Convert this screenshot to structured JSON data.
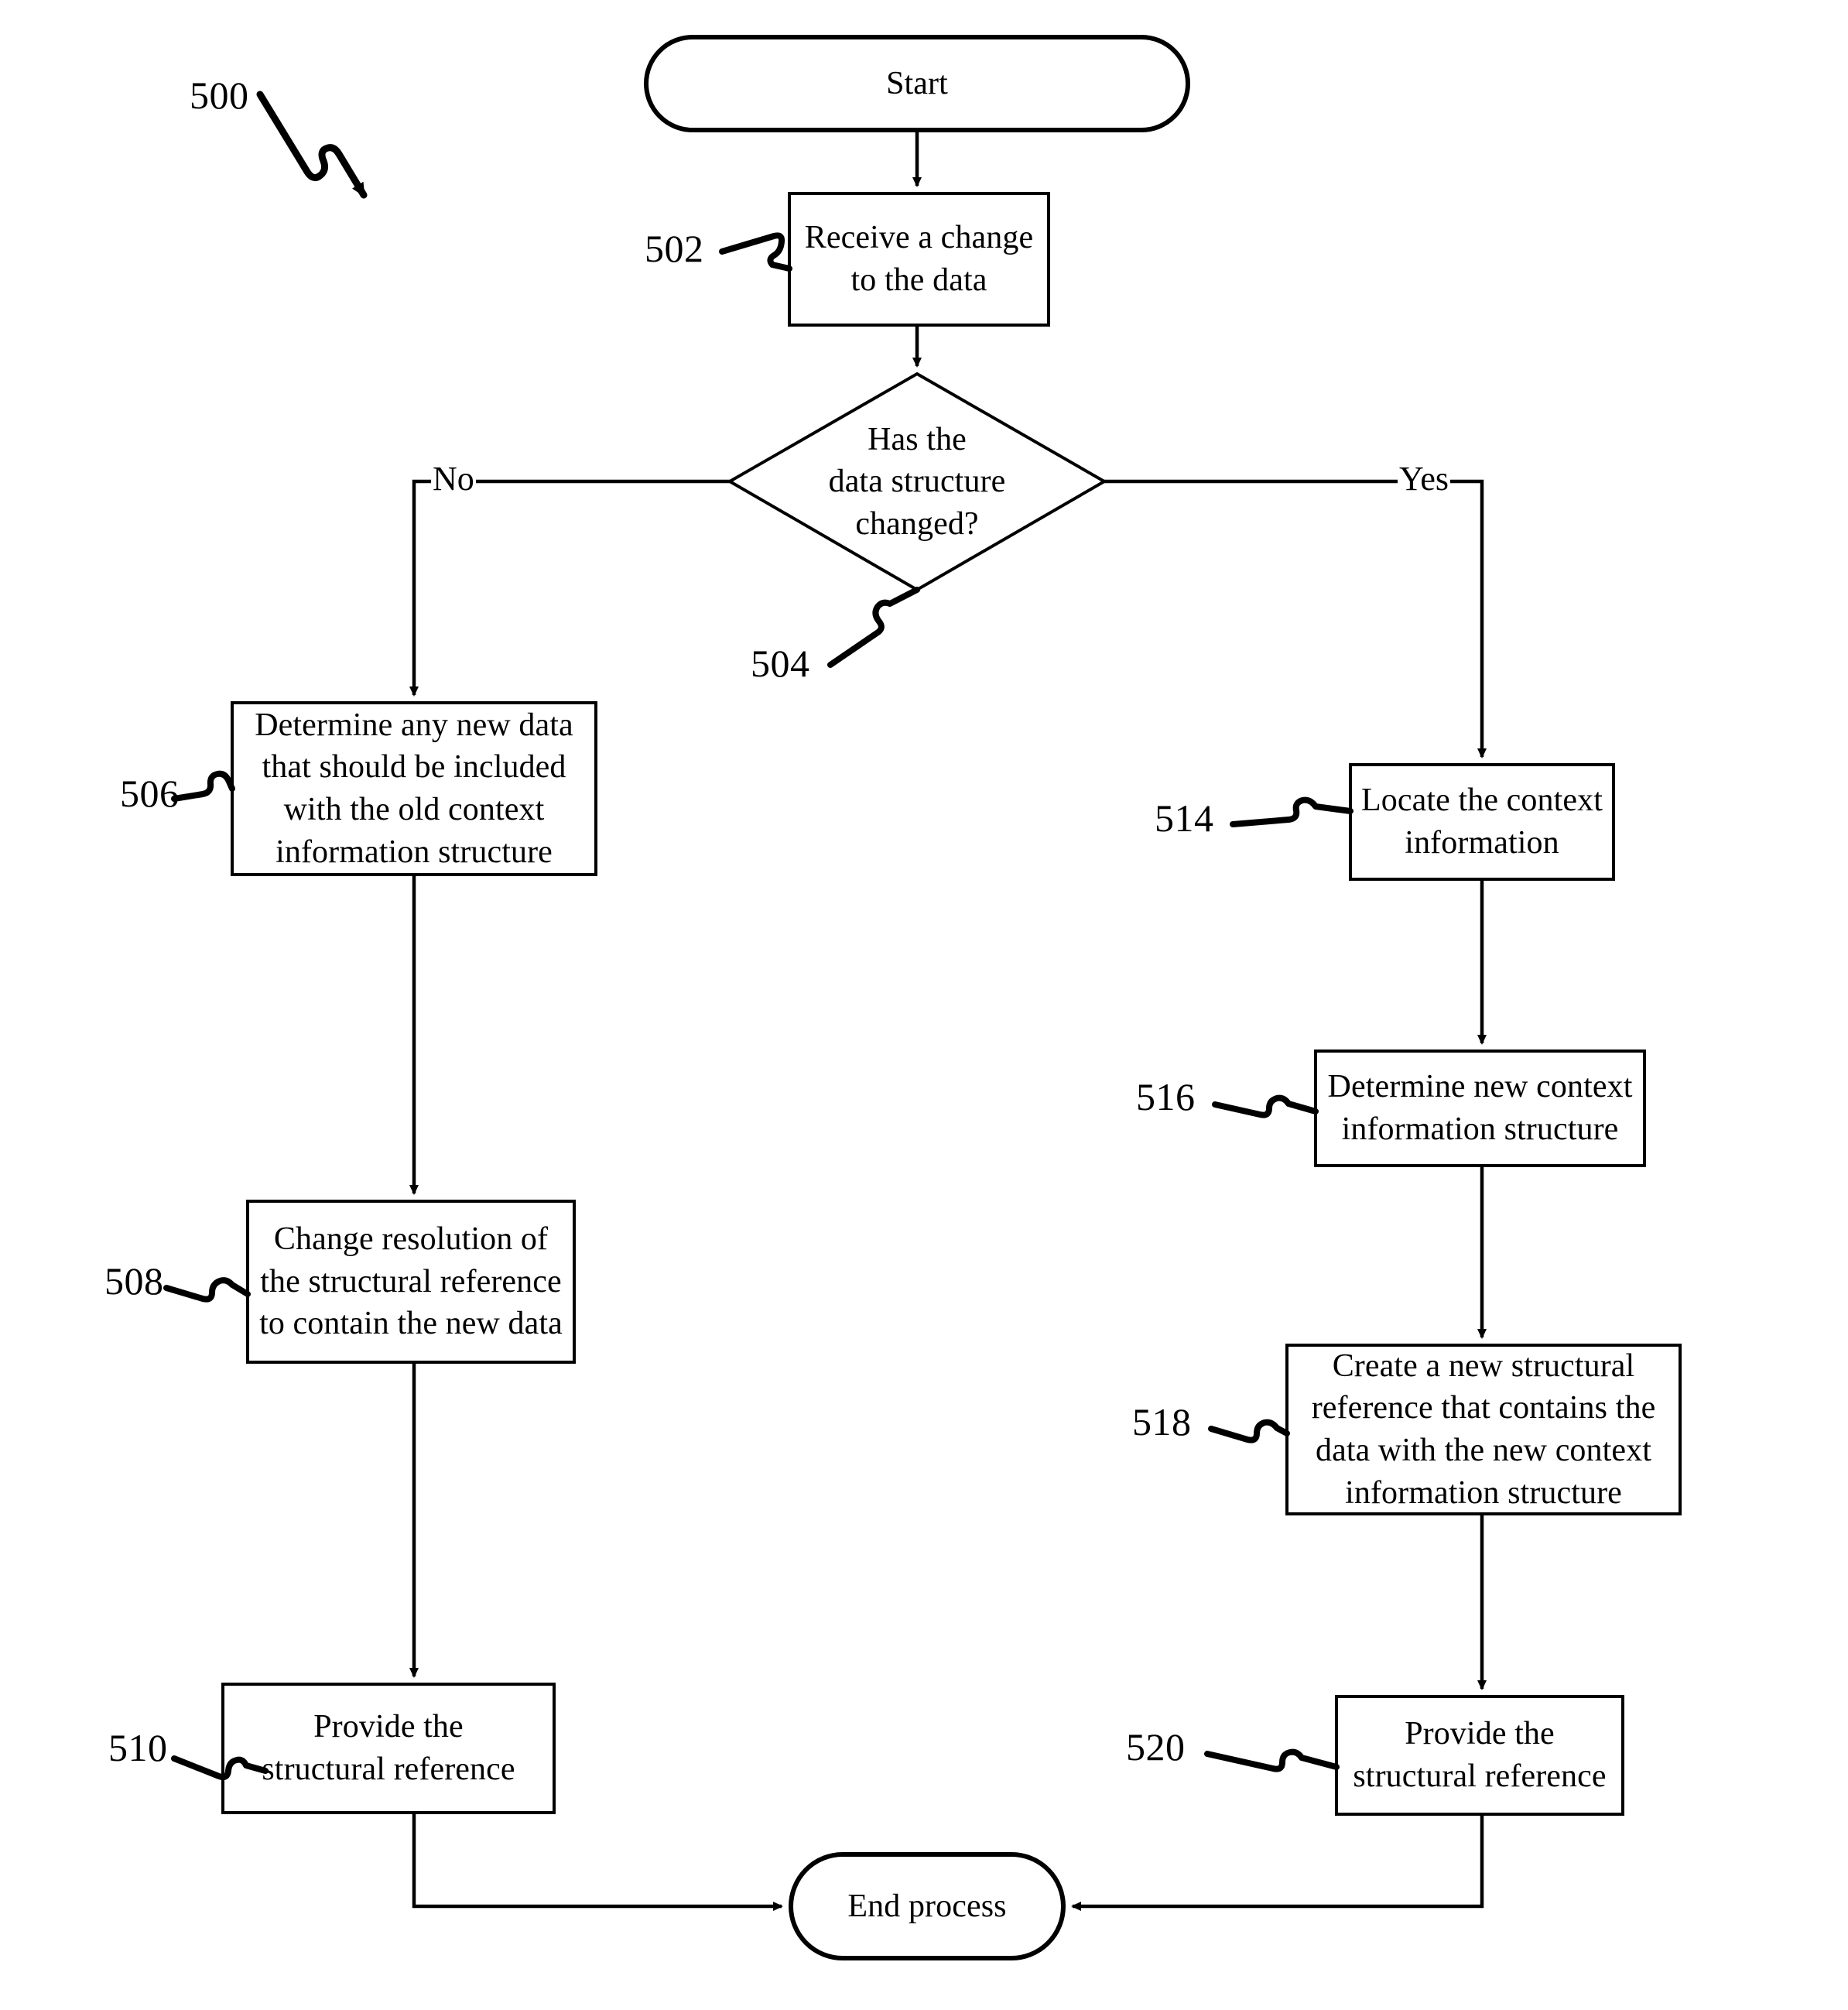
{
  "figure": {
    "number": "500",
    "type": "process-flowchart"
  },
  "nodes": {
    "start": {
      "label": "Start",
      "shape": "terminator"
    },
    "end": {
      "label": "End process",
      "shape": "terminator"
    },
    "step502": {
      "ref": "502",
      "shape": "process",
      "line1": "Receive a change",
      "line2": "to the data"
    },
    "decision504": {
      "ref": "504",
      "shape": "decision",
      "line1": "Has the",
      "line2": "data structure",
      "line3": "changed?"
    },
    "step506": {
      "ref": "506",
      "shape": "process",
      "line1": "Determine any new data",
      "line2": "that should be included",
      "line3": "with the old context",
      "line4": "information structure"
    },
    "step508": {
      "ref": "508",
      "shape": "process",
      "line1": "Change resolution of",
      "line2": "the structural reference",
      "line3": "to contain the new data"
    },
    "step510": {
      "ref": "510",
      "shape": "process",
      "line1": "Provide the",
      "line2": "structural reference"
    },
    "step514": {
      "ref": "514",
      "shape": "process",
      "line1": "Locate the context",
      "line2": "information"
    },
    "step516": {
      "ref": "516",
      "shape": "process",
      "line1": "Determine new context",
      "line2": "information structure"
    },
    "step518": {
      "ref": "518",
      "shape": "process",
      "line1": "Create a new structural",
      "line2": "reference that contains the",
      "line3": "data with the new context",
      "line4": "information structure"
    },
    "step520": {
      "ref": "520",
      "shape": "process",
      "line1": "Provide the",
      "line2": "structural reference"
    }
  },
  "branches": {
    "no_label": "No",
    "yes_label": "Yes"
  },
  "colors": {
    "stroke": "#000000",
    "fill": "#ffffff",
    "text": "#000000"
  }
}
